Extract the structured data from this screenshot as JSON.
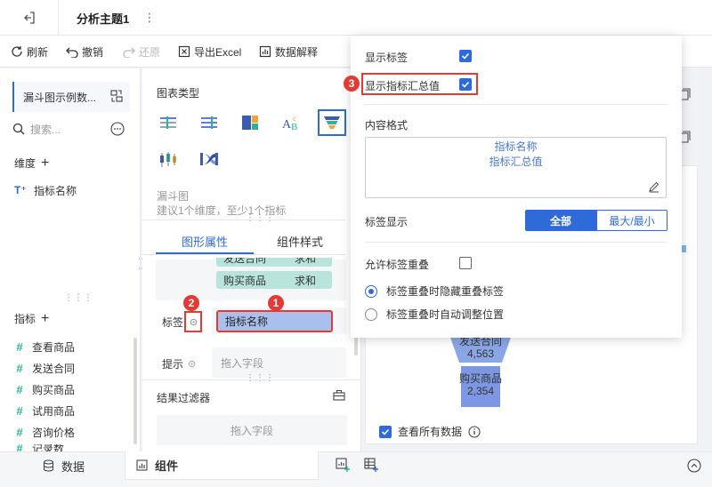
{
  "header": {
    "tab_title": "分析主题1"
  },
  "toolbar": {
    "refresh": "刷新",
    "undo": "撤销",
    "redo": "还原",
    "export_excel": "导出Excel",
    "data_explain": "数据解释"
  },
  "left_panel": {
    "dataset_name": "漏斗图示例数...",
    "search_placeholder": "搜索...",
    "dimension_title": "维度",
    "dimensions": [
      "指标名称"
    ],
    "metric_title": "指标",
    "metrics": [
      "查看商品",
      "发送合同",
      "购买商品",
      "试用商品",
      "咨询价格",
      "记录数"
    ]
  },
  "mid_panel": {
    "chart_type_title": "图表类型",
    "chart_name": "漏斗图",
    "chart_hint": "建议1个维度，至少1个指标",
    "tab_properties": "图形属性",
    "tab_style": "组件样式",
    "field_partial": "发送合同",
    "field_partial_agg": "求和",
    "field_buy": "购买商品",
    "field_buy_agg": "求和",
    "label_row": "标签",
    "label_field": "指标名称",
    "tooltip_row": "提示",
    "drop_placeholder": "拖入字段",
    "result_filter": "结果过滤器",
    "filter_placeholder": "拖入字段"
  },
  "canvas": {
    "funnel": [
      {
        "name": "发送合同",
        "value": "4,563"
      },
      {
        "name": "购买商品",
        "value": "2,354"
      }
    ],
    "view_all": "查看所有数据"
  },
  "popover": {
    "show_label": "显示标签",
    "show_total": "显示指标汇总值",
    "content_format": "内容格式",
    "format_line1": "指标名称",
    "format_line2": "指标汇总值",
    "label_display": "标签显示",
    "btn_all": "全部",
    "btn_minmax": "最大/最小",
    "allow_overlap": "允许标签重叠",
    "radio_hide": "标签重叠时隐藏重叠标签",
    "radio_adjust": "标签重叠时自动调整位置"
  },
  "badges": {
    "one": "1",
    "two": "2",
    "three": "3"
  },
  "bottom": {
    "data_tab": "数据",
    "component_tab": "组件"
  },
  "colors": {
    "accent": "#2f6bd8",
    "alert": "#e53935",
    "teal_pill": "#b9e4dc",
    "blue_pill": "#a9c0ef"
  }
}
